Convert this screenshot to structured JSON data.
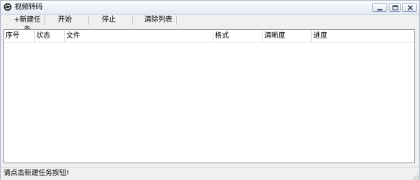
{
  "window": {
    "title": "视频转码",
    "icon": "refresh-icon",
    "controls": [
      "minimize-icon",
      "maximize-icon",
      "close-icon"
    ]
  },
  "toolbar": {
    "new_task": "+新建任务",
    "start": "开始",
    "stop": "停止",
    "clear_list": "清除列表"
  },
  "table": {
    "columns": [
      "序号",
      "状态",
      "文件",
      "格式",
      "清晰度",
      "进度"
    ],
    "rows": []
  },
  "status": {
    "message": "请点击新建任务按钮!"
  }
}
